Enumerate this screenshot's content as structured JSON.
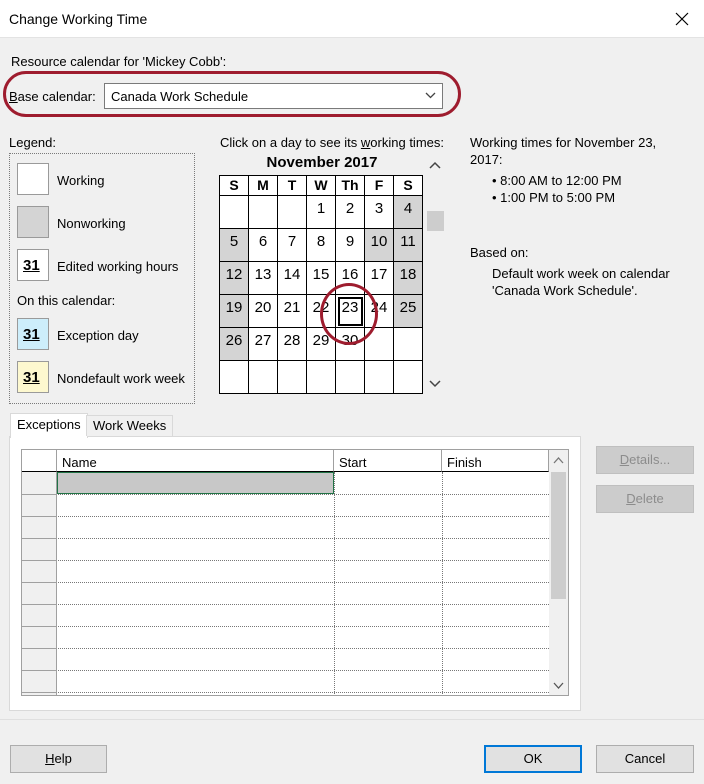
{
  "window": {
    "title": "Change Working Time",
    "close_glyph": "close-icon"
  },
  "resource_label": "Resource calendar for 'Mickey Cobb':",
  "base_calendar": {
    "label_prefix_ul": "B",
    "label_rest": "ase calendar:",
    "value": "Canada Work Schedule"
  },
  "legend": {
    "title": "Legend:",
    "working": "Working",
    "nonworking": "Nonworking",
    "edited": "Edited working hours",
    "on_this_calendar": "On this calendar:",
    "exception": "Exception day",
    "nondefault": "Nondefault work week",
    "swatch_num": "31",
    "colors": {
      "exception_bg": "#cdeefb",
      "nondefault_bg": "#fdf8cf",
      "nonworking_bg": "#d4d4d4"
    }
  },
  "calendar": {
    "instruction_pre": "Click on a day to see its ",
    "instruction_ul": "w",
    "instruction_post": "orking times:",
    "month_title": "November 2017",
    "weekdays": [
      "S",
      "M",
      "T",
      "W",
      "Th",
      "F",
      "S"
    ],
    "weeks": [
      [
        "",
        "",
        "",
        "1",
        "2",
        "3",
        "4"
      ],
      [
        "5",
        "6",
        "7",
        "8",
        "9",
        "10",
        "11"
      ],
      [
        "12",
        "13",
        "14",
        "15",
        "16",
        "17",
        "18"
      ],
      [
        "19",
        "20",
        "21",
        "22",
        "23",
        "24",
        "25"
      ],
      [
        "26",
        "27",
        "28",
        "29",
        "30",
        "",
        ""
      ],
      [
        "",
        "",
        "",
        "",
        "",
        "",
        ""
      ]
    ],
    "nonworking_dates": [
      "4",
      "5",
      "10",
      "11",
      "12",
      "18",
      "19",
      "25",
      "26"
    ],
    "selected_date": "23"
  },
  "working_times": {
    "heading_line1": "Working times for November 23,",
    "heading_line2": "2017:",
    "times": [
      "• 8:00 AM to 12:00 PM",
      "• 1:00 PM to 5:00 PM"
    ],
    "based_on_label": "Based on:",
    "based_on_line1": "Default work week on calendar",
    "based_on_line2": "'Canada Work Schedule'."
  },
  "tabs": [
    {
      "label": "Exceptions",
      "active": true
    },
    {
      "label": "Work Weeks",
      "active": false
    }
  ],
  "table": {
    "columns": [
      "Name",
      "Start",
      "Finish"
    ]
  },
  "side_buttons": {
    "details_ul": "D",
    "details_rest": "etails...",
    "delete_ul": "D",
    "delete_rest": "elete"
  },
  "footer": {
    "help_ul": "H",
    "help_rest": "elp",
    "ok": "OK",
    "cancel": "Cancel"
  },
  "accent_color": "#0078d7",
  "annotation_color": "#9e1c2e"
}
